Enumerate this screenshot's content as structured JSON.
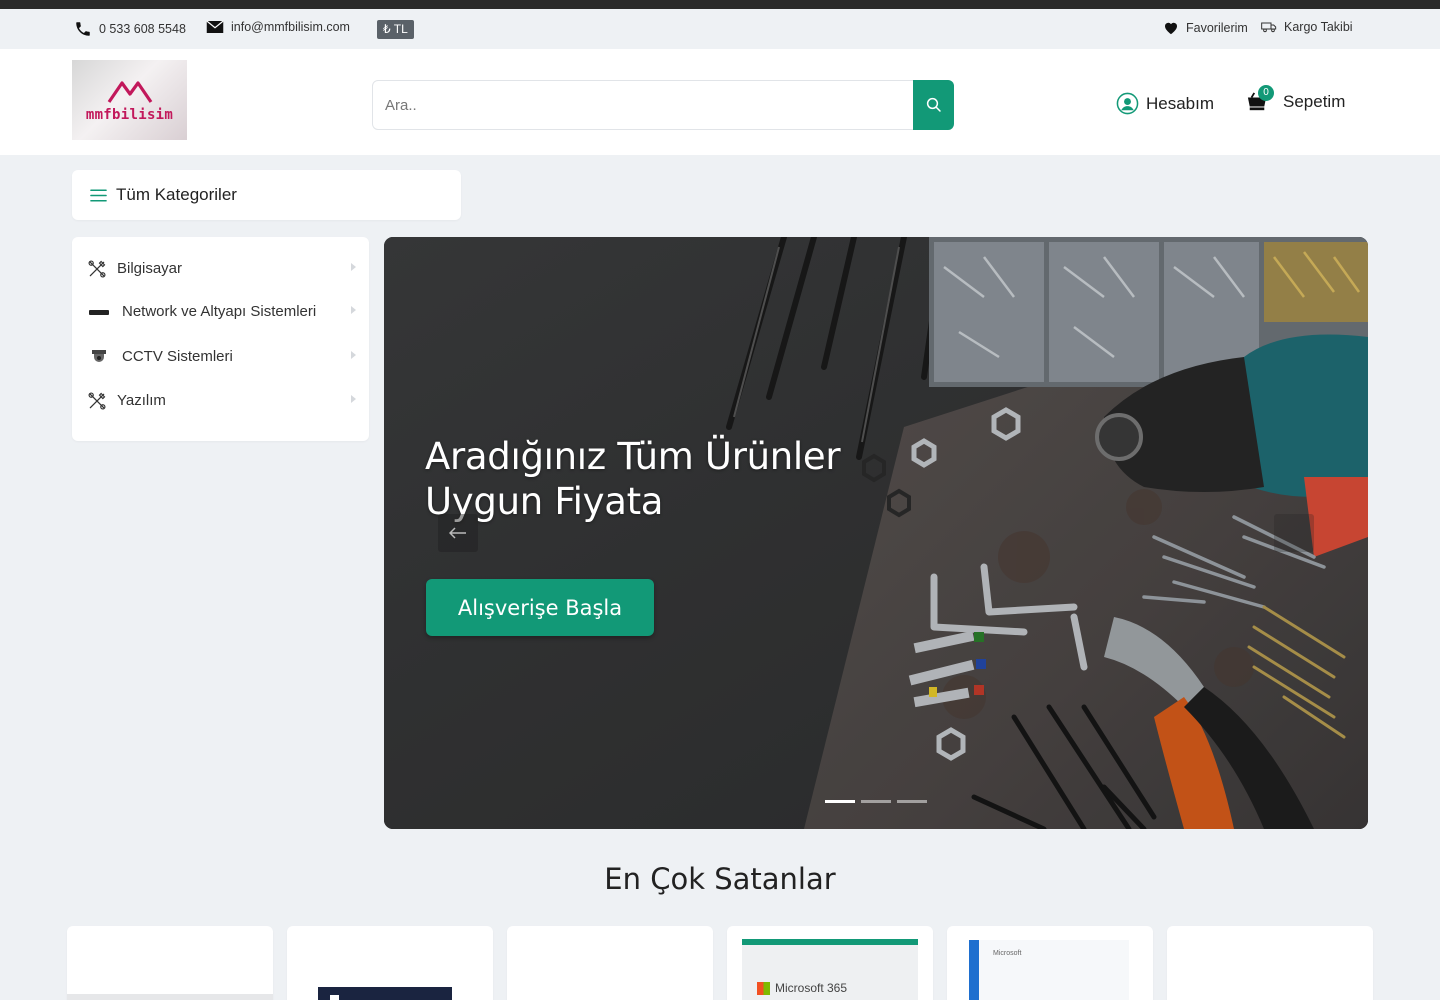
{
  "utility": {
    "phone": "0 533 608 5548",
    "email": "info@mmfbilisim.com",
    "currency": "₺ TL",
    "favorites": "Favorilerim",
    "tracking": "Kargo Takibi"
  },
  "header": {
    "logo_text": "mmfbilisim",
    "search_placeholder": "Ara..",
    "account": "Hesabım",
    "cart": "Sepetim",
    "cart_count": "0"
  },
  "categories": {
    "toggle_label": "Tüm Kategoriler",
    "items": [
      {
        "label": "Bilgisayar",
        "icon": "tools-icon"
      },
      {
        "label": "Network ve Altyapı Sistemleri",
        "icon": "network-device-icon"
      },
      {
        "label": "CCTV Sistemleri",
        "icon": "camera-icon"
      },
      {
        "label": "Yazılım",
        "icon": "tools-icon"
      }
    ]
  },
  "hero": {
    "title_line1": "Aradığınız Tüm Ürünler",
    "title_line2": "Uygun Fiyata",
    "cta": "Alışverişe Başla",
    "slides": 3,
    "active_slide": 1
  },
  "bestsellers": {
    "title": "En Çok Satanlar",
    "products": [
      {
        "thumb_text": ""
      },
      {
        "thumb_text": ""
      },
      {
        "thumb_text": ""
      },
      {
        "thumb_text": "Microsoft 365"
      },
      {
        "thumb_text": "Microsoft"
      },
      {
        "thumb_text": ""
      }
    ]
  },
  "colors": {
    "accent": "#129977",
    "page_bg": "#eef1f4",
    "logo_pink": "#c2185b"
  }
}
